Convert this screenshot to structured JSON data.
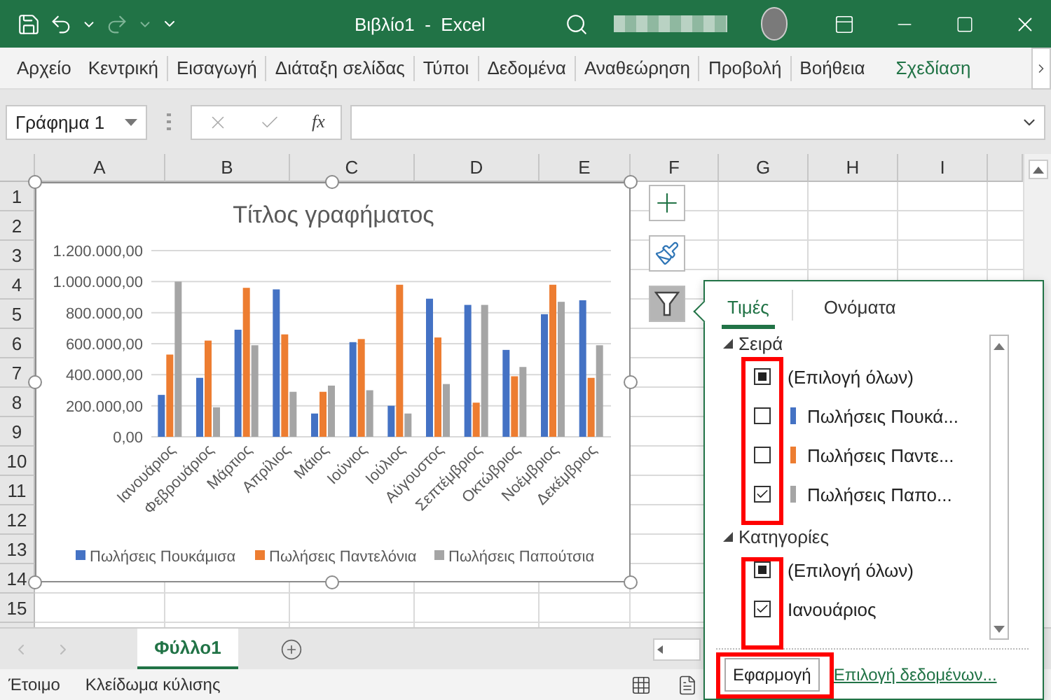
{
  "title_bar": {
    "title": "Βιβλίο1  -  Excel"
  },
  "ribbon_tabs": [
    {
      "label": "Αρχείο",
      "selected": false
    },
    {
      "label": "Κεντρική",
      "selected": false
    },
    {
      "label": "Εισαγωγή",
      "selected": false
    },
    {
      "label": "Διάταξη σελίδας",
      "selected": false
    },
    {
      "label": "Τύποι",
      "selected": false
    },
    {
      "label": "Δεδομένα",
      "selected": false
    },
    {
      "label": "Αναθεώρηση",
      "selected": false
    },
    {
      "label": "Προβολή",
      "selected": false
    },
    {
      "label": "Βοήθεια",
      "selected": false
    },
    {
      "label": "Σχεδίαση",
      "selected": true
    }
  ],
  "name_box": {
    "value": "Γράφημα 1"
  },
  "formula_bar": {
    "function_button": "fx"
  },
  "columns": [
    "A",
    "B",
    "C",
    "D",
    "E",
    "F",
    "G",
    "H",
    "I"
  ],
  "rows": [
    "1",
    "2",
    "3",
    "4",
    "5",
    "6",
    "7",
    "8",
    "9",
    "10",
    "11",
    "12",
    "13",
    "14",
    "15"
  ],
  "chart": {
    "chart_data": {
      "type": "bar",
      "title": "Τίτλος γραφήματος",
      "grid": true,
      "legend": true,
      "categories": [
        "Ιανουάριος",
        "Φεβρουάριος",
        "Μάρτιος",
        "Απρίλιος",
        "Μάιος",
        "Ιούνιος",
        "Ιούλιος",
        "Αύγουστος",
        "Σεπτέμβριος",
        "Οκτώβριος",
        "Νοέμβριος",
        "Δεκέμβριος"
      ],
      "series": [
        {
          "name": "Πωλήσεις Πουκάμισα",
          "color": "#4472c4",
          "values": [
            270000,
            380000,
            690000,
            950000,
            150000,
            610000,
            200000,
            890000,
            850000,
            560000,
            790000,
            880000
          ]
        },
        {
          "name": "Πωλήσεις Παντελόνια",
          "color": "#ed7d31",
          "values": [
            530000,
            620000,
            960000,
            660000,
            290000,
            630000,
            980000,
            640000,
            220000,
            390000,
            980000,
            380000
          ]
        },
        {
          "name": "Πωλήσεις Παπούτσια",
          "color": "#a5a5a5",
          "values": [
            1000000,
            190000,
            590000,
            290000,
            330000,
            300000,
            150000,
            340000,
            850000,
            450000,
            870000,
            590000
          ]
        }
      ],
      "ylim": [
        0,
        1200000
      ],
      "yticks": [
        {
          "value": 0,
          "label": "0,00"
        },
        {
          "value": 200000,
          "label": "200.000,00"
        },
        {
          "value": 400000,
          "label": "400.000,00"
        },
        {
          "value": 600000,
          "label": "600.000,00"
        },
        {
          "value": 800000,
          "label": "800.000,00"
        },
        {
          "value": 1000000,
          "label": "1.000.000,00"
        },
        {
          "value": 1200000,
          "label": "1.200.000,00"
        }
      ]
    }
  },
  "chart_tools": [
    {
      "kind": "elements",
      "selected": false
    },
    {
      "kind": "styles",
      "selected": false
    },
    {
      "kind": "filter",
      "selected": true
    }
  ],
  "filter_panel": {
    "tabs": [
      {
        "label": "Τιμές",
        "selected": true
      },
      {
        "label": "Ονόματα",
        "selected": false
      }
    ],
    "groups": [
      {
        "label": "Σειρά",
        "expanded": true,
        "items": [
          {
            "label": "(Επιλογή όλων)",
            "checked": false,
            "indeterminate": true
          },
          {
            "label": "Πωλήσεις Πουκά...",
            "checked": false,
            "indeterminate": false,
            "color": "#4472c4"
          },
          {
            "label": "Πωλήσεις Παντε...",
            "checked": false,
            "indeterminate": false,
            "color": "#ed7d31"
          },
          {
            "label": "Πωλήσεις Παπο...",
            "checked": true,
            "color": "#a5a5a5"
          }
        ]
      },
      {
        "label": "Κατηγορίες",
        "expanded": true,
        "items": [
          {
            "label": "(Επιλογή όλων)",
            "checked": false,
            "indeterminate": true
          },
          {
            "label": "Ιανουάριος",
            "checked": true
          }
        ]
      }
    ],
    "apply_button": "Εφαρμογή",
    "select_data_link": "Επιλογή δεδομένων..."
  },
  "sheet_tabs": [
    {
      "label": "Φύλλο1",
      "selected": true
    }
  ],
  "status_bar": {
    "items": [
      "Έτοιμο",
      "Κλείδωμα κύλισης"
    ]
  }
}
